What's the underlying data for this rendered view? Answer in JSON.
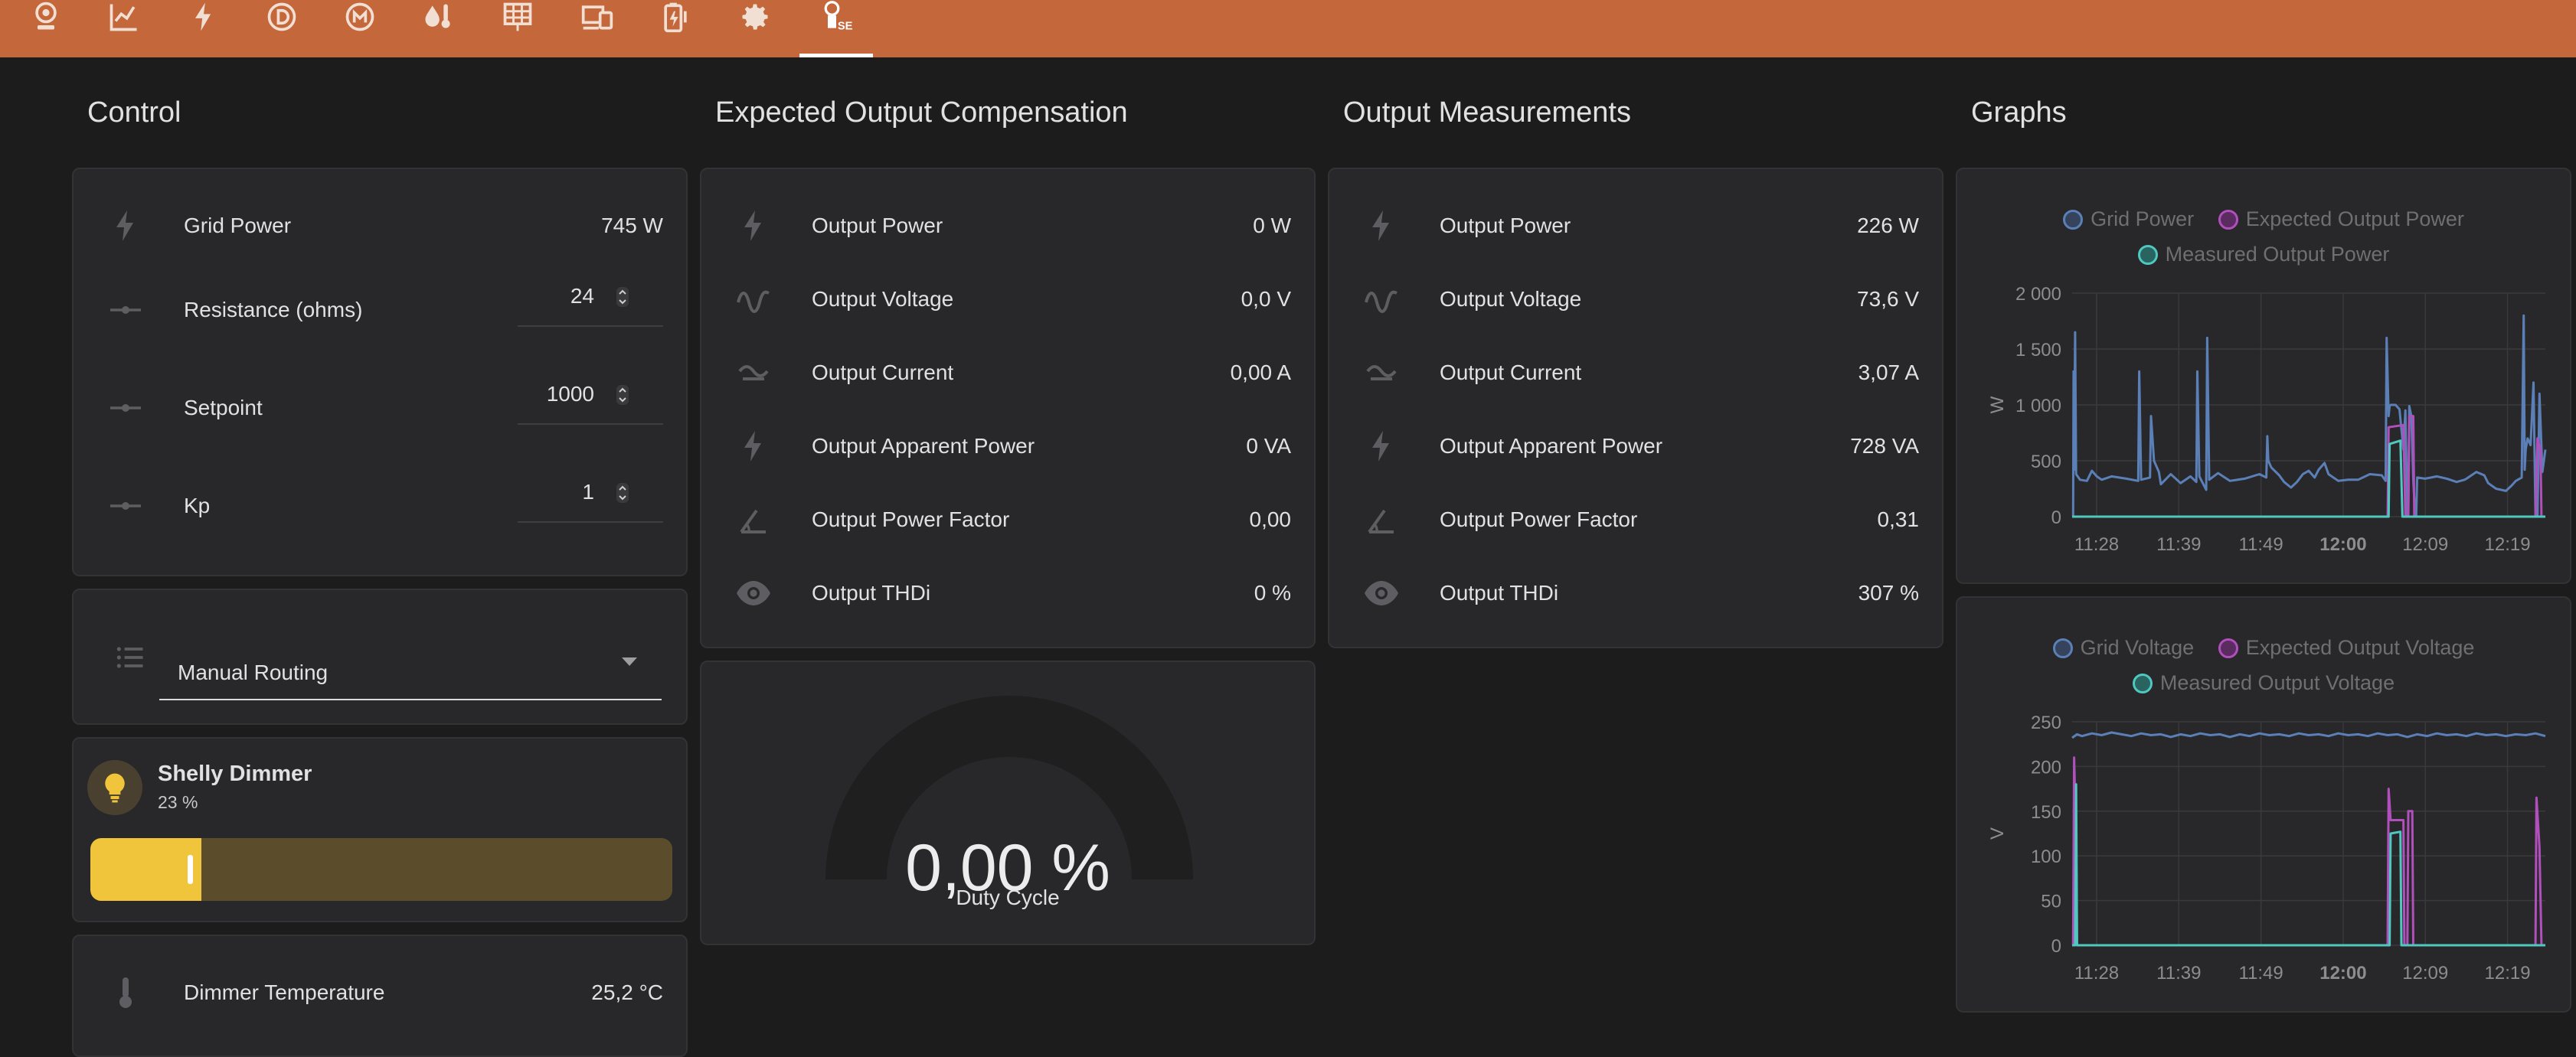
{
  "colors": {
    "topbar": "#c4683b",
    "card": "#28282a",
    "background": "#1c1c1c",
    "grid_series": "#5b7fb7",
    "expected_series": "#b14fbd",
    "measured_series": "#4fc8c0",
    "slider_fill": "#f0c53c"
  },
  "tabs": [
    {
      "icon": "webcam-icon"
    },
    {
      "icon": "chart-line-icon"
    },
    {
      "icon": "flash-icon"
    },
    {
      "icon": "circle-d-icon"
    },
    {
      "icon": "circle-m-icon"
    },
    {
      "icon": "water-thermometer-icon"
    },
    {
      "icon": "solar-panel-icon"
    },
    {
      "icon": "devices-icon"
    },
    {
      "icon": "battery-charging-icon"
    },
    {
      "icon": "gear-icon"
    },
    {
      "icon": "router-sea-icon",
      "label": "SEA",
      "active": true
    }
  ],
  "control": {
    "title": "Control",
    "grid_power": {
      "label": "Grid Power",
      "value": "745 W"
    },
    "inputs": [
      {
        "label": "Resistance (ohms)",
        "value": "24"
      },
      {
        "label": "Setpoint",
        "value": "1000"
      },
      {
        "label": "Kp",
        "value": "1"
      }
    ],
    "select": {
      "value": "Manual Routing"
    },
    "dimmer": {
      "name": "Shelly Dimmer",
      "state": "23 %",
      "level": 23
    },
    "temperature": {
      "label": "Dimmer Temperature",
      "value": "25,2 °C"
    }
  },
  "expected": {
    "title": "Expected Output Compensation",
    "rows": [
      {
        "icon": "flash-icon",
        "label": "Output Power",
        "value": "0 W"
      },
      {
        "icon": "sine-wave-icon",
        "label": "Output Voltage",
        "value": "0,0 V"
      },
      {
        "icon": "current-ac-icon",
        "label": "Output Current",
        "value": "0,00 A"
      },
      {
        "icon": "flash-icon",
        "label": "Output Apparent Power",
        "value": "0 VA"
      },
      {
        "icon": "angle-acute-icon",
        "label": "Output Power Factor",
        "value": "0,00"
      },
      {
        "icon": "eye-icon",
        "label": "Output THDi",
        "value": "0 %"
      }
    ],
    "gauge": {
      "value_text": "0,00 %",
      "label": "Duty Cycle",
      "fraction": 0
    }
  },
  "measurements": {
    "title": "Output Measurements",
    "rows": [
      {
        "icon": "flash-icon",
        "label": "Output Power",
        "value": "226 W"
      },
      {
        "icon": "sine-wave-icon",
        "label": "Output Voltage",
        "value": "73,6 V"
      },
      {
        "icon": "current-ac-icon",
        "label": "Output Current",
        "value": "3,07 A"
      },
      {
        "icon": "flash-icon",
        "label": "Output Apparent Power",
        "value": "728 VA"
      },
      {
        "icon": "angle-acute-icon",
        "label": "Output Power Factor",
        "value": "0,31"
      },
      {
        "icon": "eye-icon",
        "label": "Output THDi",
        "value": "307 %"
      }
    ]
  },
  "graphs": {
    "title": "Graphs"
  },
  "chart_data": [
    {
      "type": "line",
      "ylabel": "W",
      "ylim": [
        0,
        2000
      ],
      "yticks": [
        "0",
        "500",
        "1 000",
        "1 500",
        "2 000"
      ],
      "xticks": [
        "11:28",
        "11:39",
        "11:49",
        "12:00",
        "12:09",
        "12:19"
      ],
      "xtick_bold": "12:00",
      "series": [
        {
          "name": "Grid Power",
          "color": "#5b7fb7",
          "points": [
            [
              0,
              0
            ],
            [
              1,
              0
            ],
            [
              1.5,
              1300
            ],
            [
              2,
              420
            ],
            [
              3,
              1650
            ],
            [
              4,
              380
            ],
            [
              8,
              330
            ],
            [
              15,
              320
            ],
            [
              20,
              410
            ],
            [
              25,
              360
            ],
            [
              30,
              330
            ],
            [
              40,
              360
            ],
            [
              55,
              340
            ],
            [
              67,
              320
            ],
            [
              68,
              1300
            ],
            [
              70,
              330
            ],
            [
              79,
              350
            ],
            [
              80,
              900
            ],
            [
              83,
              500
            ],
            [
              88,
              400
            ],
            [
              90,
              290
            ],
            [
              100,
              380
            ],
            [
              110,
              300
            ],
            [
              120,
              360
            ],
            [
              126,
              310
            ],
            [
              127,
              1300
            ],
            [
              129,
              360
            ],
            [
              136,
              240
            ],
            [
              137,
              1600
            ],
            [
              139,
              330
            ],
            [
              148,
              390
            ],
            [
              160,
              320
            ],
            [
              175,
              340
            ],
            [
              190,
              380
            ],
            [
              197,
              350
            ],
            [
              198,
              720
            ],
            [
              199,
              500
            ],
            [
              202,
              440
            ],
            [
              210,
              370
            ],
            [
              215,
              310
            ],
            [
              222,
              260
            ],
            [
              228,
              310
            ],
            [
              234,
              380
            ],
            [
              240,
              410
            ],
            [
              246,
              350
            ],
            [
              250,
              420
            ],
            [
              256,
              480
            ],
            [
              260,
              380
            ],
            [
              270,
              320
            ],
            [
              280,
              330
            ],
            [
              290,
              330
            ],
            [
              302,
              380
            ],
            [
              314,
              370
            ],
            [
              318,
              320
            ],
            [
              319,
              1600
            ],
            [
              321,
              900
            ],
            [
              322,
              990
            ],
            [
              323,
              1000
            ],
            [
              328,
              1000
            ],
            [
              332,
              960
            ],
            [
              336,
              600
            ],
            [
              338,
              950
            ],
            [
              340,
              0
            ],
            [
              341,
              0
            ],
            [
              342,
              990
            ],
            [
              344,
              900
            ],
            [
              346,
              330
            ],
            [
              348,
              0
            ],
            [
              349,
              0
            ],
            [
              350,
              350
            ],
            [
              358,
              340
            ],
            [
              370,
              360
            ],
            [
              380,
              340
            ],
            [
              390,
              310
            ],
            [
              398,
              330
            ],
            [
              400,
              340
            ],
            [
              410,
              400
            ],
            [
              418,
              370
            ],
            [
              422,
              300
            ],
            [
              430,
              250
            ],
            [
              440,
              230
            ],
            [
              446,
              280
            ],
            [
              450,
              320
            ],
            [
              456,
              350
            ],
            [
              458,
              1800
            ],
            [
              459,
              420
            ],
            [
              460,
              600
            ],
            [
              462,
              700
            ],
            [
              465,
              640
            ],
            [
              468,
              1200
            ],
            [
              470,
              0
            ],
            [
              472,
              0
            ],
            [
              474,
              1100
            ],
            [
              477,
              400
            ],
            [
              480,
              600
            ]
          ]
        },
        {
          "name": "Expected Output Power",
          "color": "#b14fbd",
          "points": [
            [
              0,
              0
            ],
            [
              320,
              0
            ],
            [
              321,
              800
            ],
            [
              336,
              820
            ],
            [
              338,
              0
            ],
            [
              341,
              0
            ],
            [
              342,
              900
            ],
            [
              346,
              900
            ],
            [
              347,
              0
            ],
            [
              470,
              0
            ],
            [
              472,
              700
            ],
            [
              475,
              600
            ],
            [
              476,
              0
            ],
            [
              480,
              0
            ]
          ]
        },
        {
          "name": "Measured Output Power",
          "color": "#4fc8c0",
          "points": [
            [
              0,
              0
            ],
            [
              321,
              0
            ],
            [
              322,
              650
            ],
            [
              333,
              680
            ],
            [
              335,
              0
            ],
            [
              480,
              0
            ]
          ]
        }
      ]
    },
    {
      "type": "line",
      "ylabel": "V",
      "ylim": [
        0,
        250
      ],
      "yticks": [
        "0",
        "50",
        "100",
        "150",
        "200",
        "250"
      ],
      "xticks": [
        "11:28",
        "11:39",
        "11:49",
        "12:00",
        "12:09",
        "12:19"
      ],
      "xtick_bold": "12:00",
      "series": [
        {
          "name": "Grid Voltage",
          "color": "#5b7fb7",
          "points": [
            [
              0,
              232
            ],
            [
              5,
              236
            ],
            [
              10,
              234
            ],
            [
              20,
              237
            ],
            [
              30,
              235
            ],
            [
              40,
              238
            ],
            [
              50,
              236
            ],
            [
              60,
              234
            ],
            [
              70,
              237
            ],
            [
              80,
              235
            ],
            [
              90,
              236
            ],
            [
              100,
              233
            ],
            [
              110,
              236
            ],
            [
              120,
              234
            ],
            [
              130,
              237
            ],
            [
              140,
              235
            ],
            [
              150,
              236
            ],
            [
              160,
              233
            ],
            [
              170,
              236
            ],
            [
              180,
              234
            ],
            [
              190,
              237
            ],
            [
              200,
              235
            ],
            [
              210,
              236
            ],
            [
              220,
              234
            ],
            [
              230,
              237
            ],
            [
              240,
              235
            ],
            [
              250,
              236
            ],
            [
              260,
              234
            ],
            [
              270,
              237
            ],
            [
              280,
              235
            ],
            [
              290,
              236
            ],
            [
              300,
              234
            ],
            [
              310,
              237
            ],
            [
              320,
              235
            ],
            [
              330,
              236
            ],
            [
              340,
              233
            ],
            [
              350,
              236
            ],
            [
              360,
              234
            ],
            [
              370,
              237
            ],
            [
              380,
              235
            ],
            [
              390,
              236
            ],
            [
              400,
              234
            ],
            [
              410,
              237
            ],
            [
              420,
              235
            ],
            [
              430,
              236
            ],
            [
              440,
              234
            ],
            [
              450,
              236
            ],
            [
              460,
              235
            ],
            [
              470,
              237
            ],
            [
              480,
              234
            ]
          ]
        },
        {
          "name": "Expected Output Voltage",
          "color": "#b14fbd",
          "points": [
            [
              0,
              0
            ],
            [
              1,
              0
            ],
            [
              2,
              210
            ],
            [
              4,
              120
            ],
            [
              5,
              0
            ],
            [
              320,
              0
            ],
            [
              321,
              175
            ],
            [
              323,
              140
            ],
            [
              336,
              140
            ],
            [
              337,
              0
            ],
            [
              340,
              0
            ],
            [
              341,
              150
            ],
            [
              345,
              150
            ],
            [
              346,
              0
            ],
            [
              470,
              0
            ],
            [
              471,
              165
            ],
            [
              474,
              110
            ],
            [
              476,
              0
            ],
            [
              480,
              0
            ]
          ]
        },
        {
          "name": "Measured Output Voltage",
          "color": "#4fc8c0",
          "points": [
            [
              0,
              0
            ],
            [
              3,
              0
            ],
            [
              4,
              180
            ],
            [
              5,
              0
            ],
            [
              322,
              0
            ],
            [
              323,
              125
            ],
            [
              333,
              127
            ],
            [
              334,
              0
            ],
            [
              480,
              0
            ]
          ]
        }
      ]
    }
  ]
}
